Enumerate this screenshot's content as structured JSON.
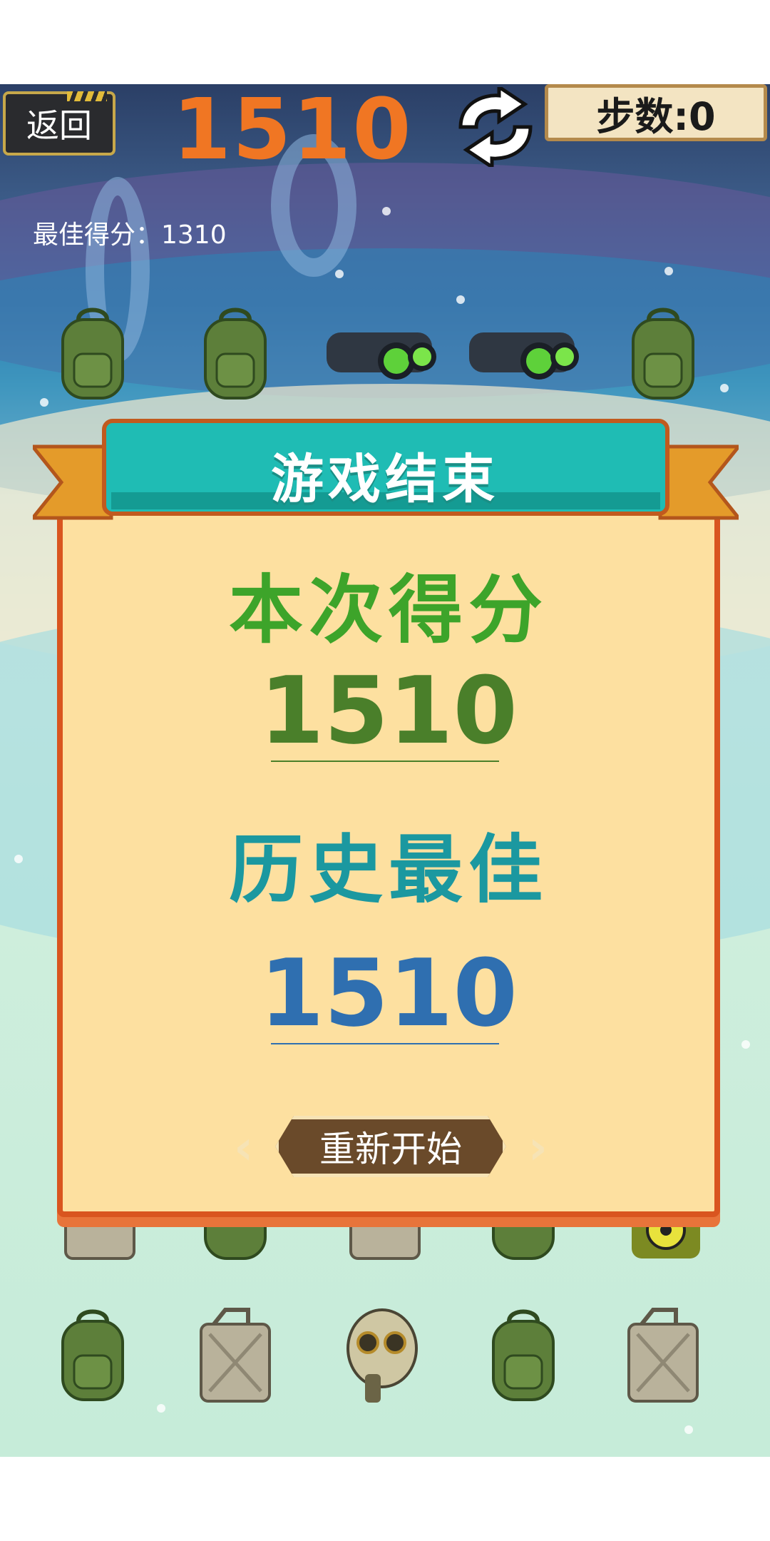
{
  "top_bar": {
    "back_label": "返回",
    "score": "1510",
    "steps_label": "步数:0",
    "best_score_line": "最佳得分：1310"
  },
  "grid": {
    "row1": [
      "backpack",
      "backpack",
      "night-vision-goggles",
      "night-vision-goggles",
      "backpack"
    ],
    "row_partial": [
      "jerry-can",
      "backpack",
      "jerry-can",
      "backpack",
      "biohazard-barrel"
    ],
    "row_bottom": [
      "backpack",
      "jerry-can",
      "gas-mask",
      "backpack",
      "jerry-can"
    ]
  },
  "dialog": {
    "title": "游戏结束",
    "current_label": "本次得分",
    "current_score": "1510",
    "best_label": "历史最佳",
    "best_score": "1510",
    "restart_label": "重新开始"
  },
  "colors": {
    "score_orange": "#f07623",
    "current_green": "#3da42a",
    "best_teal": "#1b98a0",
    "best_blue": "#2f6fb0",
    "panel": "#fde0a0",
    "panel_border": "#d9551f",
    "ribbon": "#1fbcb4"
  }
}
